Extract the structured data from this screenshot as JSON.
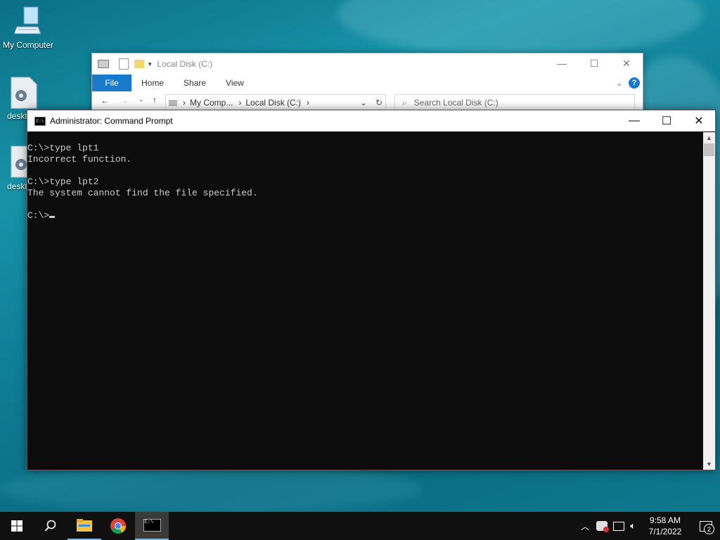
{
  "desktop": {
    "icons": [
      {
        "label": "My Computer",
        "icon": "computer-icon"
      },
      {
        "label": "deskt",
        "icon": "settings-file-icon"
      },
      {
        "label": "deskt",
        "icon": "settings-file-icon"
      }
    ]
  },
  "explorer": {
    "title": "Local Disk (C:)",
    "ribbon_tabs": [
      "File",
      "Home",
      "Share",
      "View"
    ],
    "breadcrumb": [
      "My Comp...",
      "Local Disk (C:)"
    ],
    "search_placeholder": "Search Local Disk (C:)"
  },
  "cmd": {
    "title": "Administrator: Command Prompt",
    "lines": [
      "",
      "C:\\>type lpt1",
      "Incorrect function.",
      "",
      "C:\\>type lpt2",
      "The system cannot find the file specified.",
      "",
      "C:\\>"
    ]
  },
  "taskbar": {
    "time": "9:58 AM",
    "date": "7/1/2022",
    "notification_count": "2",
    "pinned": [
      "start-icon",
      "search-icon",
      "file-explorer-icon",
      "chrome-icon",
      "cmd-icon"
    ]
  }
}
